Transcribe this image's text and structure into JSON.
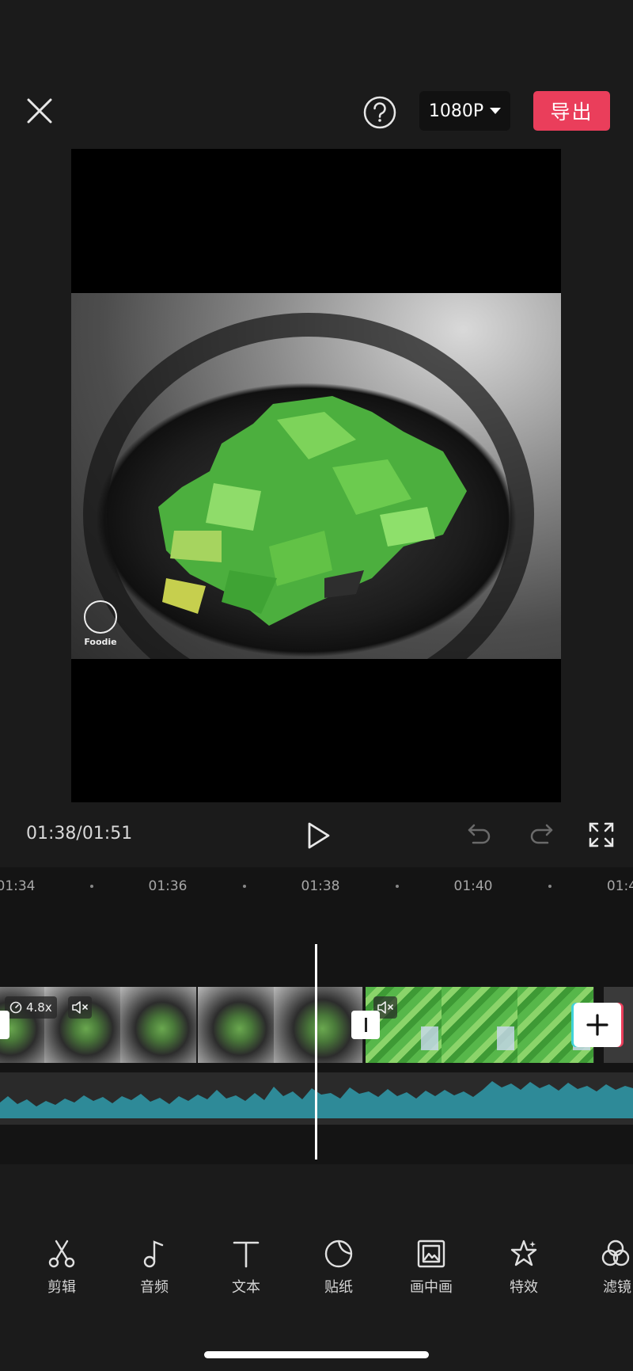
{
  "topbar": {
    "close_icon": "close-icon",
    "help_icon": "question-circle-icon",
    "resolution": "1080P",
    "export_label": "导出",
    "accent_color": "#ea3e5b"
  },
  "preview": {
    "watermark_text": "Foodie"
  },
  "playback": {
    "timecode": "01:38/01:51",
    "play_icon": "play-icon",
    "undo_icon": "undo-icon",
    "redo_icon": "redo-icon",
    "fullscreen_icon": "fullscreen-icon"
  },
  "timeline": {
    "ruler_labels": [
      "01:34",
      "01:36",
      "01:38",
      "01:40",
      "01:4"
    ],
    "clip_speed": "4.8x",
    "add_icon": "plus-icon"
  },
  "toolbar": {
    "items": [
      {
        "label": "剪辑",
        "icon": "scissors-icon"
      },
      {
        "label": "音频",
        "icon": "music-note-icon"
      },
      {
        "label": "文本",
        "icon": "text-icon"
      },
      {
        "label": "贴纸",
        "icon": "sticker-icon"
      },
      {
        "label": "画中画",
        "icon": "picture-in-picture-icon"
      },
      {
        "label": "特效",
        "icon": "effects-star-icon"
      },
      {
        "label": "滤镜",
        "icon": "filter-icon"
      }
    ]
  }
}
